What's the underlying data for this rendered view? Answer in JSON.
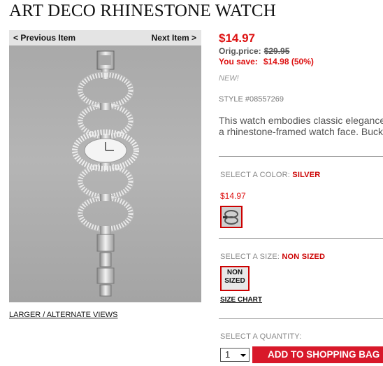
{
  "product": {
    "title": "ART DECO RHINESTONE WATCH",
    "price": "$14.97",
    "orig_label": "Orig.price:",
    "orig_price": "$29.95",
    "save_label": "You save:",
    "save_value": "$14.98 (50%)",
    "new_badge": "NEW!",
    "style": "STYLE #08557269",
    "description": "This watch embodies classic elegance a rhinestone-framed watch face. Buck",
    "description_lines": [
      "This watch embodies classic elegance",
      "a rhinestone-framed watch face. Buck"
    ]
  },
  "nav": {
    "prev_label": "< Previous Item",
    "next_label": "Next Item >"
  },
  "image": {
    "alt_views_label": "LARGER / ALTERNATE VIEWS"
  },
  "color": {
    "label": "SELECT A COLOR:",
    "selected": "SILVER",
    "swatch_price": "$14.97"
  },
  "size": {
    "label": "SELECT A SIZE:",
    "selected": "NON SIZED",
    "option_line1": "NON",
    "option_line2": "SIZED",
    "chart_label": "SIZE CHART"
  },
  "quantity": {
    "label": "SELECT A QUANTITY:",
    "value": "1",
    "add_button": "ADD TO SHOPPING BAG"
  },
  "colors": {
    "accent": "#d8182a",
    "price_red": "#dd1111"
  }
}
